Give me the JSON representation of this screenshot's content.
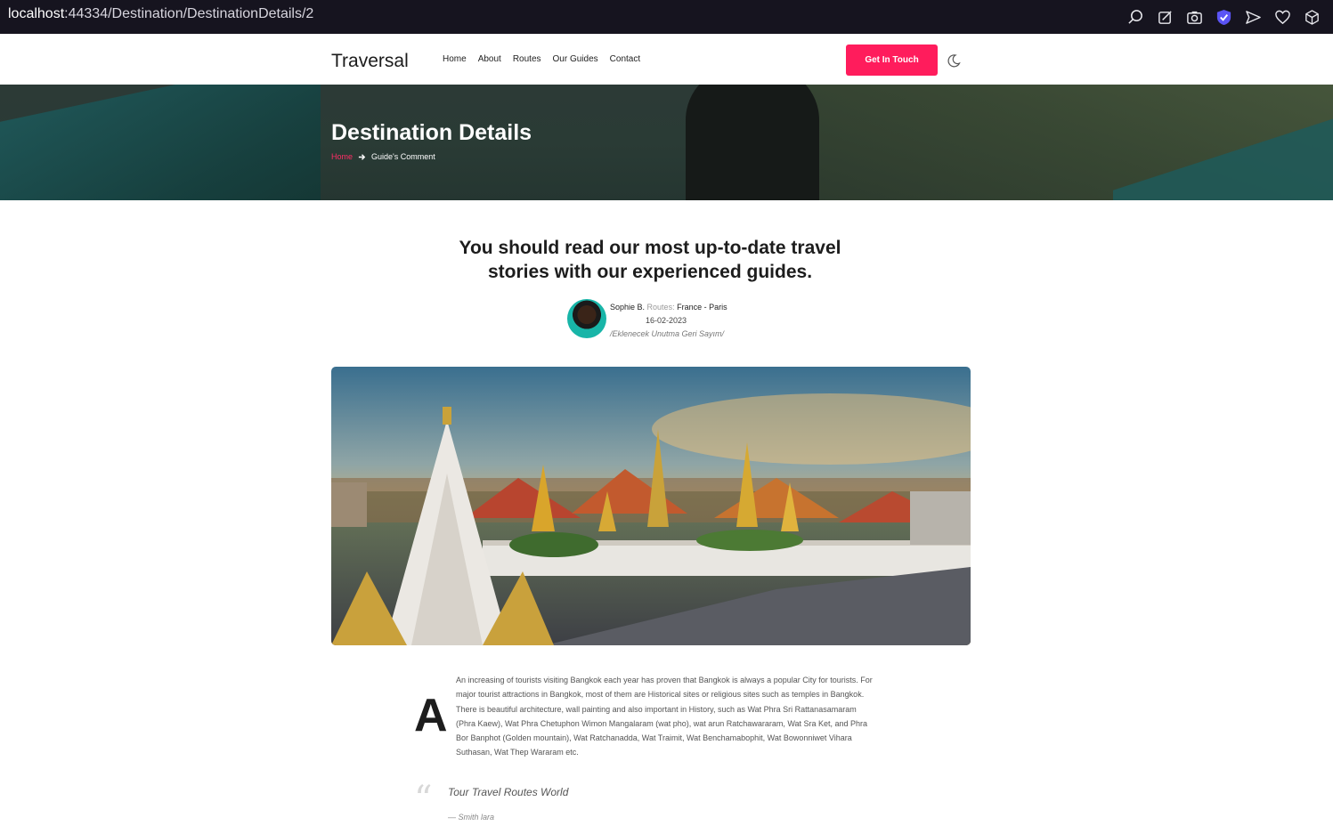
{
  "browser": {
    "url_host": "localhost",
    "url_path": ":44334/Destination/DestinationDetails/2",
    "icons": [
      "search-icon",
      "edit-icon",
      "camera-icon",
      "shield-icon",
      "send-icon",
      "heart-icon",
      "cube-icon"
    ]
  },
  "nav": {
    "brand": "Traversal",
    "links": [
      "Home",
      "About",
      "Routes",
      "Our Guides",
      "Contact"
    ],
    "cta_label": "Get In Touch",
    "accent_color": "#ff1c5c"
  },
  "hero": {
    "title": "Destination Details",
    "breadcrumb_home": "Home",
    "breadcrumb_current": "Guide's Comment"
  },
  "post": {
    "headline_line1": "You should read our most up-to-date travel",
    "headline_line2": "stories with our experienced guides.",
    "author": "Sophie B.",
    "routes_label": "Routes:",
    "route": "France - Paris",
    "date": "16-02-2023",
    "note": "/Eklenecek Unutma Geri Sayım/",
    "dropcap": "A",
    "body": "An increasing of tourists visiting Bangkok each year has proven that Bangkok is always a popular City for tourists. For major tourist attractions in Bangkok, most of them are Historical sites or religious sites such as temples in Bangkok. There is beautiful architecture, wall painting and also important in History, such as Wat Phra Sri Rattanasamaram (Phra Kaew), Wat Phra Chetuphon Wimon Mangalaram (wat pho), wat arun Ratchawararam, Wat Sra Ket, and Phra Bor Banphot (Golden mountain), Wat Ratchanadda, Wat Traimit, Wat Benchamabophit, Wat Bowonniwet Vihara Suthasan, Wat Thep Wararam etc.",
    "quote": "Tour Travel Routes World",
    "quote_author": "— Smith lara"
  }
}
